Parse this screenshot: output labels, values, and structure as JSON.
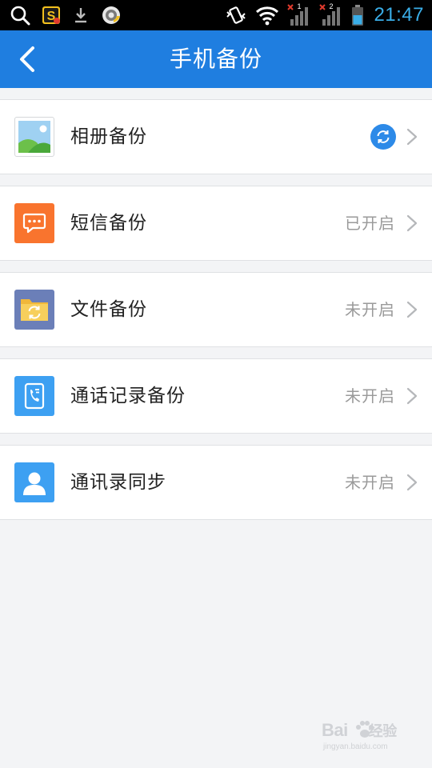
{
  "status_bar": {
    "time": "21:47",
    "sim1_label": "1",
    "sim2_label": "2",
    "colors": {
      "background": "#000000",
      "clock": "#3aaee8"
    }
  },
  "header": {
    "title": "手机备份",
    "background": "#1f7ee0"
  },
  "backups": [
    {
      "label": "相册备份",
      "status": "",
      "icon": "photo-icon",
      "sync": true
    },
    {
      "label": "短信备份",
      "status": "已开启",
      "icon": "message-icon"
    },
    {
      "label": "文件备份",
      "status": "未开启",
      "icon": "folder-sync-icon"
    },
    {
      "label": "通话记录备份",
      "status": "未开启",
      "icon": "call-log-icon"
    },
    {
      "label": "通讯录同步",
      "status": "未开启",
      "icon": "contact-icon"
    }
  ],
  "watermark": {
    "brand": "Bai",
    "brand2": "经验",
    "url": "jingyan.baidu.com"
  }
}
